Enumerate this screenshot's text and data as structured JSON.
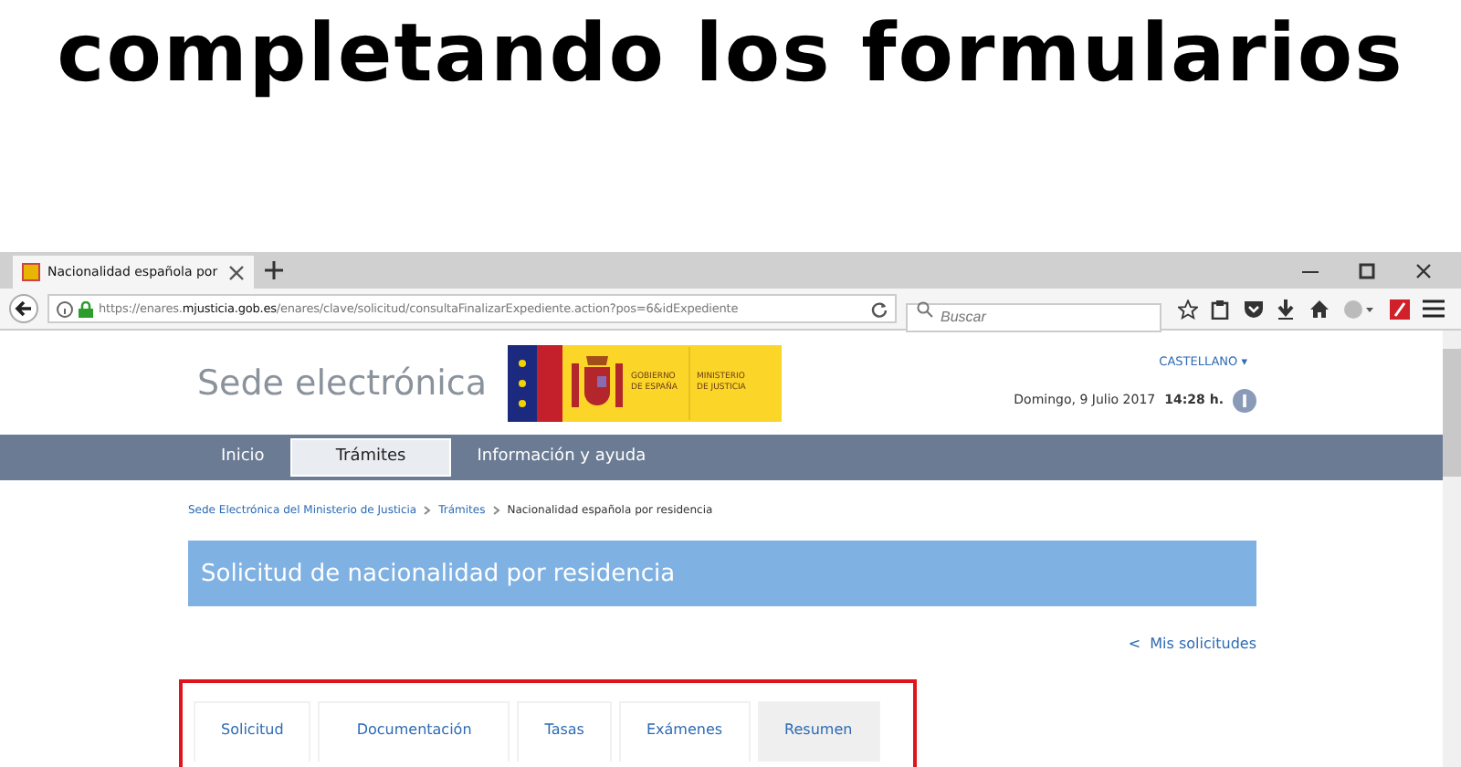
{
  "headline": "completando los formularios",
  "browser": {
    "tab_title": "Nacionalidad española por",
    "url_prefix": "https://enares.",
    "url_domain": "mjusticia.gob.es",
    "url_path": "/enares/clave/solicitud/consultaFinalizarExpediente.action?pos=6&idExpediente",
    "search": {
      "placeholder": "Buscar"
    }
  },
  "site": {
    "title": "Sede electrónica",
    "logo_text_1": "GOBIERNO DE ESPAÑA",
    "logo_text_2": "MINISTERIO DE JUSTICIA",
    "language": "CASTELLANO ▾",
    "date": "Domingo, 9 Julio 2017",
    "time": "14:28 h.",
    "nav": [
      {
        "label": "Inicio",
        "selected": false
      },
      {
        "label": "Trámites",
        "selected": true
      },
      {
        "label": "Información y ayuda",
        "selected": false
      }
    ],
    "breadcrumb": [
      {
        "label": "Sede Electrónica del Ministerio de Justicia",
        "link": true
      },
      {
        "label": "Trámites",
        "link": true
      },
      {
        "label": "Nacionalidad española por residencia",
        "link": false
      }
    ],
    "banner": "Solicitud de nacionalidad por residencia",
    "back_link": "<  Mis solicitudes",
    "tabs": [
      {
        "label": "Solicitud",
        "selected": false
      },
      {
        "label": "Documentación",
        "selected": false
      },
      {
        "label": "Tasas",
        "selected": false
      },
      {
        "label": "Exámenes",
        "selected": false
      },
      {
        "label": "Resumen",
        "selected": true
      }
    ]
  }
}
